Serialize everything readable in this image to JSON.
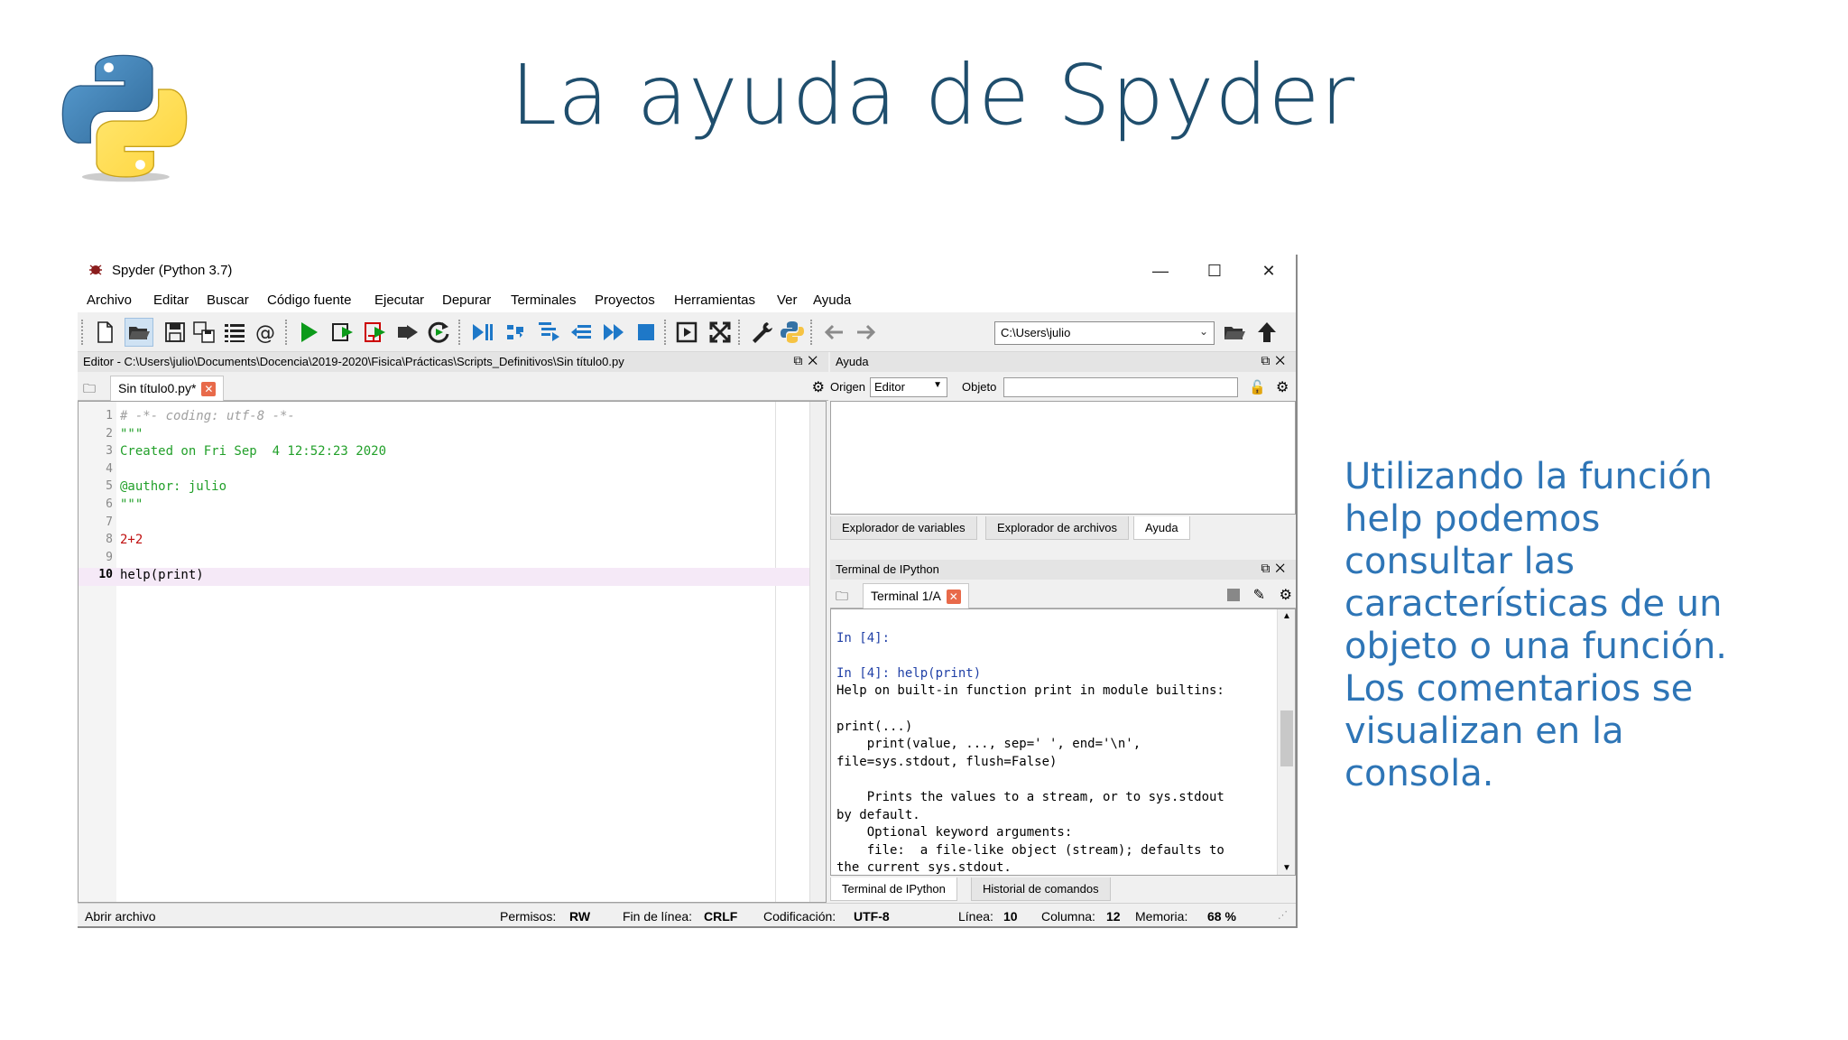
{
  "slide": {
    "title": "La ayuda de Spyder",
    "side_text": [
      "Utilizando la función",
      "help podemos",
      "consultar las",
      "características de un",
      "objeto o una función.",
      "Los comentarios se",
      "visualizan en la",
      "consola."
    ]
  },
  "window": {
    "title": "Spyder (Python 3.7)",
    "minimize": "—",
    "maximize": "☐",
    "close": "✕"
  },
  "menu": [
    "Archivo",
    "Editar",
    "Buscar",
    "Código fuente",
    "Ejecutar",
    "Depurar",
    "Terminales",
    "Proyectos",
    "Herramientas",
    "Ver",
    "Ayuda"
  ],
  "toolbar": {
    "path": "C:\\Users\\julio",
    "icons": [
      "new-file-icon",
      "open-file-icon",
      "save-icon",
      "save-all-icon",
      "list-icon",
      "at-icon",
      "run-icon",
      "run-cell-icon",
      "run-cell-advance-icon",
      "run-selection-icon",
      "rerun-icon",
      "debug-icon",
      "step-icon",
      "step-into-icon",
      "step-return-icon",
      "continue-icon",
      "stop-icon",
      "maximize-pane-icon",
      "fullscreen-icon",
      "preferences-icon",
      "python-path-icon",
      "back-icon",
      "forward-icon",
      "browse-folder-icon",
      "parent-dir-icon"
    ]
  },
  "editor": {
    "header": "Editor - C:\\Users\\julio\\Documents\\Docencia\\2019-2020\\Fisica\\Prácticas\\Scripts_Definitivos\\Sin título0.py",
    "tab": "Sin título0.py*",
    "lines": [
      {
        "n": "1",
        "text": "# -*- coding: utf-8 -*-"
      },
      {
        "n": "2",
        "text": "\"\"\""
      },
      {
        "n": "3",
        "text": "Created on Fri Sep  4 12:52:23 2020"
      },
      {
        "n": "4",
        "text": ""
      },
      {
        "n": "5",
        "text": "@author: julio"
      },
      {
        "n": "6",
        "text": "\"\"\""
      },
      {
        "n": "7",
        "text": ""
      },
      {
        "n": "8",
        "text": "2+2"
      },
      {
        "n": "9",
        "text": ""
      },
      {
        "n": "10",
        "text": "help(print)"
      }
    ]
  },
  "help": {
    "header": "Ayuda",
    "origin_label": "Origen",
    "origin_value": "Editor",
    "object_label": "Objeto",
    "object_value": "",
    "tabs": [
      "Explorador de variables",
      "Explorador de archivos",
      "Ayuda"
    ]
  },
  "console": {
    "header": "Terminal de IPython",
    "tab": "Terminal 1/A",
    "lines": [
      "",
      "In [4]:",
      "",
      "In [4]: help(print)",
      "Help on built-in function print in module builtins:",
      "",
      "print(...)",
      "    print(value, ..., sep=' ', end='\\n',",
      "file=sys.stdout, flush=False)",
      "",
      "    Prints the values to a stream, or to sys.stdout",
      "by default.",
      "    Optional keyword arguments:",
      "    file:  a file-like object (stream); defaults to",
      "the current sys.stdout."
    ],
    "bottom_tabs": [
      "Terminal de IPython",
      "Historial de comandos"
    ]
  },
  "status": {
    "message": "Abrir archivo",
    "permissions_label": "Permisos:",
    "permissions_value": "RW",
    "eol_label": "Fin de línea:",
    "eol_value": "CRLF",
    "encoding_label": "Codificación:",
    "encoding_value": "UTF-8",
    "line_label": "Línea:",
    "line_value": "10",
    "column_label": "Columna:",
    "column_value": "12",
    "memory_label": "Memoria:",
    "memory_value": "68 %"
  }
}
